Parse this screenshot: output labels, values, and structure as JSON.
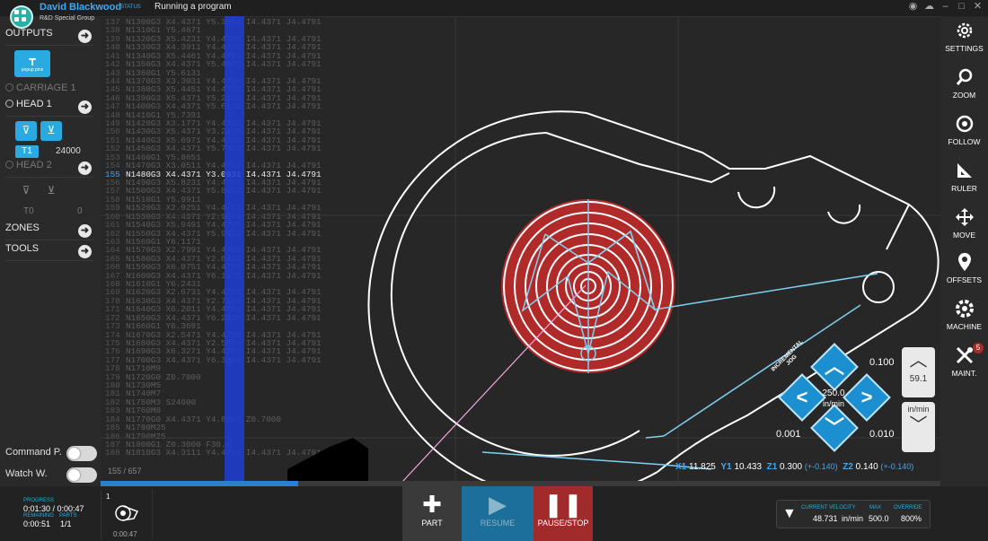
{
  "window": {
    "user_name": "David Blackwood",
    "user_status": "STATUS",
    "org_name": "R&D Special Group",
    "run_status": "Running a program"
  },
  "sidebar": {
    "outputs_label": "OUTPUTS",
    "output_button_label": "popup pins",
    "carriage_label": "CARRIAGE 1",
    "head1_label": "HEAD 1",
    "head1_tool": "T1",
    "head1_speed": "24000",
    "head2_label": "HEAD 2",
    "head2_tool": "T0",
    "head2_speed": "0",
    "zones_label": "ZONES",
    "tools_label": "TOOLS",
    "command_label": "Command P.",
    "watch_label": "Watch W."
  },
  "code": {
    "line_count": "155 / 657",
    "progress_fraction": 0.235,
    "lines": [
      {
        "n": "137",
        "t": "N1300G3 X4.4371 Y5.3651 I4.4371 J4.4791"
      },
      {
        "n": "138",
        "t": "N1310G1 Y5.4671"
      },
      {
        "n": "139",
        "t": "N1320G3 X5.4231 Y4.4791 I4.4371 J4.4791"
      },
      {
        "n": "140",
        "t": "N1330G3 X4.3911 Y4.4791 I4.4371 J4.4791"
      },
      {
        "n": "141",
        "t": "N1340G3 X5.4461 Y4.4791 I4.4371 J4.4791"
      },
      {
        "n": "142",
        "t": "N1350G3 X4.4371 Y5.4831 I4.4371 J4.4791"
      },
      {
        "n": "143",
        "t": "N1360G1 Y5.6131"
      },
      {
        "n": "144",
        "t": "N1370G3 X3.3031 Y4.4791 I4.4371 J4.4791"
      },
      {
        "n": "145",
        "t": "N1380G3 X5.4451 Y4.4791 I4.4371 J4.4791"
      },
      {
        "n": "146",
        "t": "N1390G3 X5.4371 Y5.2131 I4.4371 J4.4791"
      },
      {
        "n": "147",
        "t": "N1400G3 X4.4371 Y5.6131 I4.4371 J4.4791"
      },
      {
        "n": "148",
        "t": "N1410G1 Y5.7391"
      },
      {
        "n": "149",
        "t": "N1420G3 X3.1771 Y4.4791 I4.4371 J4.4791"
      },
      {
        "n": "150",
        "t": "N1430G3 X5.4371 Y3.2191 I4.4371 J4.4791"
      },
      {
        "n": "151",
        "t": "N1440G3 X5.6971 Y4.4791 I4.4371 J4.4791"
      },
      {
        "n": "152",
        "t": "N1450G3 X4.4371 Y5.7391 I4.4371 J4.4791"
      },
      {
        "n": "153",
        "t": "N1460G1 Y5.8651"
      },
      {
        "n": "154",
        "t": "N1470G3 X3.0511 Y4.4791 I4.4371 J4.4791"
      },
      {
        "n": "155",
        "t": "N1480G3 X4.4371 Y3.0931 I4.4371 J4.4791",
        "current": true
      },
      {
        "n": "156",
        "t": "N1490G3 X5.8231 Y4.4791 I4.4371 J4.4791"
      },
      {
        "n": "157",
        "t": "N1500G3 X4.4371 Y5.8651 I4.4371 J4.4791"
      },
      {
        "n": "158",
        "t": "N1510G1 Y5.9911"
      },
      {
        "n": "159",
        "t": "N1520G3 X2.9251 Y4.4791 I4.4371 J4.4791"
      },
      {
        "n": "160",
        "t": "N1530G3 X4.4371 Y2.9671 I4.4371 J4.4791"
      },
      {
        "n": "161",
        "t": "N1540G3 X5.9491 Y4.4791 I4.4371 J4.4791"
      },
      {
        "n": "162",
        "t": "N1550G3 X4.4371 Y5.9911 I4.4371 J4.4791"
      },
      {
        "n": "163",
        "t": "N1560G1 Y6.1171"
      },
      {
        "n": "164",
        "t": "N1570G3 X2.7991 Y4.4791 I4.4371 J4.4791"
      },
      {
        "n": "165",
        "t": "N1580G3 X4.4371 Y2.8411 I4.4371 J4.4791"
      },
      {
        "n": "166",
        "t": "N1590G3 X6.0751 Y4.4791 I4.4371 J4.4791"
      },
      {
        "n": "167",
        "t": "N1600G3 X4.4371 Y6.1171 I4.4371 J4.4791"
      },
      {
        "n": "168",
        "t": "N1610G1 Y6.2431"
      },
      {
        "n": "169",
        "t": "N1620G3 X2.6731 Y4.4791 I4.4371 J4.4791"
      },
      {
        "n": "170",
        "t": "N1630G3 X4.4371 Y2.7151 I4.4371 J4.4791"
      },
      {
        "n": "171",
        "t": "N1640G3 X6.2011 Y4.4791 I4.4371 J4.4791"
      },
      {
        "n": "172",
        "t": "N1650G3 X4.4371 Y6.2431 I4.4371 J4.4791"
      },
      {
        "n": "173",
        "t": "N1660G1 Y6.3691"
      },
      {
        "n": "174",
        "t": "N1670G3 X2.5471 Y4.4791 I4.4371 J4.4791"
      },
      {
        "n": "175",
        "t": "N1680G3 X4.4371 Y2.5891 I4.4371 J4.4791"
      },
      {
        "n": "176",
        "t": "N1690G3 X6.3271 Y4.4791 I4.4371 J4.4791"
      },
      {
        "n": "177",
        "t": "N1700G3 X4.4371 Y6.3691 I4.4371 J4.4791"
      },
      {
        "n": "178",
        "t": "N1710M9"
      },
      {
        "n": "179",
        "t": "N1720G0 Z0.7000"
      },
      {
        "n": "180",
        "t": "N1730M5"
      },
      {
        "n": "181",
        "t": "N1740M7"
      },
      {
        "n": "182",
        "t": "N1750M3 S24000"
      },
      {
        "n": "183",
        "t": "N1760M8"
      },
      {
        "n": "184",
        "t": "N1770G0 X4.4371 Y4.8051 Z0.7000"
      },
      {
        "n": "185",
        "t": "N1780M25"
      },
      {
        "n": "186",
        "t": "N1790M25"
      },
      {
        "n": "187",
        "t": "N1800G1 Z0.3000 F30.0"
      },
      {
        "n": "188",
        "t": "N1810G3 X4.3111 Y4.4791 I4.4371 J4.4791 F150.0"
      }
    ]
  },
  "jog": {
    "title": "INCREMENTAL JOG",
    "step_top": "0.100",
    "step_left": "0.001",
    "step_right": "0.010",
    "feed": "250.0",
    "feed_unit": "in/min",
    "speed_value": "59.1",
    "unit_label": "in/min"
  },
  "coords": {
    "x_label": "X1",
    "x_val": "11.825",
    "y_label": "Y1",
    "y_val": "10.433",
    "z1_label": "Z1",
    "z1_val": "0.300",
    "z1_offset": "(+-0.140)",
    "z2_label": "Z2",
    "z2_val": "0.140",
    "z2_offset": "(+-0.140)"
  },
  "rightbar": [
    {
      "label": "SETTINGS",
      "icon": "settings-icon"
    },
    {
      "label": "ZOOM",
      "icon": "zoom-icon"
    },
    {
      "label": "FOLLOW",
      "icon": "follow-icon"
    },
    {
      "label": "RULER",
      "icon": "ruler-icon"
    },
    {
      "label": "MOVE",
      "icon": "move-icon"
    },
    {
      "label": "OFFSETS",
      "icon": "offsets-icon"
    },
    {
      "label": "MACHINE",
      "icon": "machine-icon"
    },
    {
      "label": "MAINT.",
      "icon": "maint-icon",
      "badge": "5"
    }
  ],
  "bottom": {
    "progress_label": "PROGRESS",
    "progress_value": "0:01:30 / 0:00:47",
    "remaining_label": "REMAINING",
    "remaining_value": "0:00:51",
    "parts_label": "PARTS",
    "parts_value": "1/1",
    "job_number": "1",
    "job_time": "0:00:47",
    "part_label": "PART",
    "resume_label": "RESUME",
    "pause_label": "PAUSE/STOP",
    "velocity_label": "CURRENT VELOCITY",
    "velocity_value": "48.731",
    "velocity_unit": "in/min",
    "max_label": "MAX",
    "max_value": "500.0",
    "override_label": "OVERRIDE",
    "override_value": "800%"
  },
  "colors": {
    "accent": "#29abe2",
    "toolpath": "#7fd0f0",
    "pocket": "#b12a2a",
    "pause": "#a12a2a",
    "resume": "#1c6f9a"
  }
}
